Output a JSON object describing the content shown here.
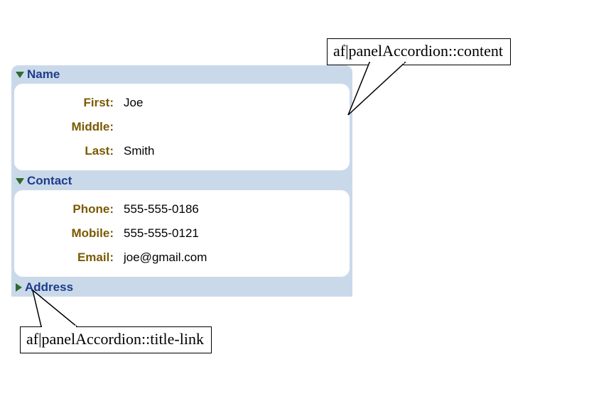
{
  "sections": {
    "name": {
      "title": "Name",
      "first_label": "First:",
      "first_value": "Joe",
      "middle_label": "Middle:",
      "middle_value": "",
      "last_label": "Last:",
      "last_value": "Smith"
    },
    "contact": {
      "title": "Contact",
      "phone_label": "Phone:",
      "phone_value": "555-555-0186",
      "mobile_label": "Mobile:",
      "mobile_value": "555-555-0121",
      "email_label": "Email:",
      "email_value": "joe@gmail.com"
    },
    "address": {
      "title": "Address"
    }
  },
  "callouts": {
    "content": "af|panelAccordion::content",
    "title_link": "af|panelAccordion::title-link"
  }
}
